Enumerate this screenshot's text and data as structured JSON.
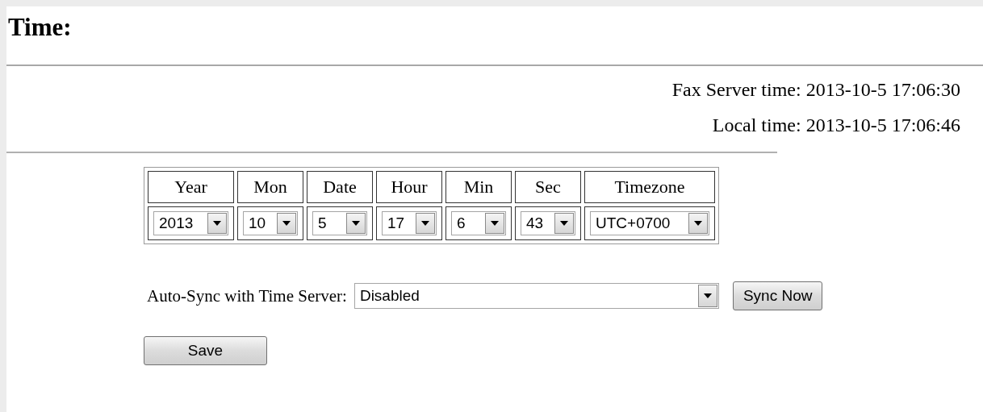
{
  "page": {
    "title": "Time:"
  },
  "clock_lines": [
    {
      "text": "Fax Server time: 2013-10-5 17:06:30"
    },
    {
      "text": "Local time: 2013-10-5 17:06:46"
    }
  ],
  "datetime_table": {
    "columns": [
      {
        "heading": "Year",
        "value": "2013"
      },
      {
        "heading": "Mon",
        "value": "10"
      },
      {
        "heading": "Date",
        "value": "5"
      },
      {
        "heading": "Hour",
        "value": "17"
      },
      {
        "heading": "Min",
        "value": "6"
      },
      {
        "heading": "Sec",
        "value": "43"
      },
      {
        "heading": "Timezone",
        "value": "UTC+0700"
      }
    ]
  },
  "auto_sync": {
    "label": "Auto-Sync with Time Server:",
    "value": "Disabled"
  },
  "buttons": [
    {
      "kind": "sync",
      "label": "Sync Now"
    },
    {
      "kind": "save",
      "label": "Save"
    }
  ]
}
